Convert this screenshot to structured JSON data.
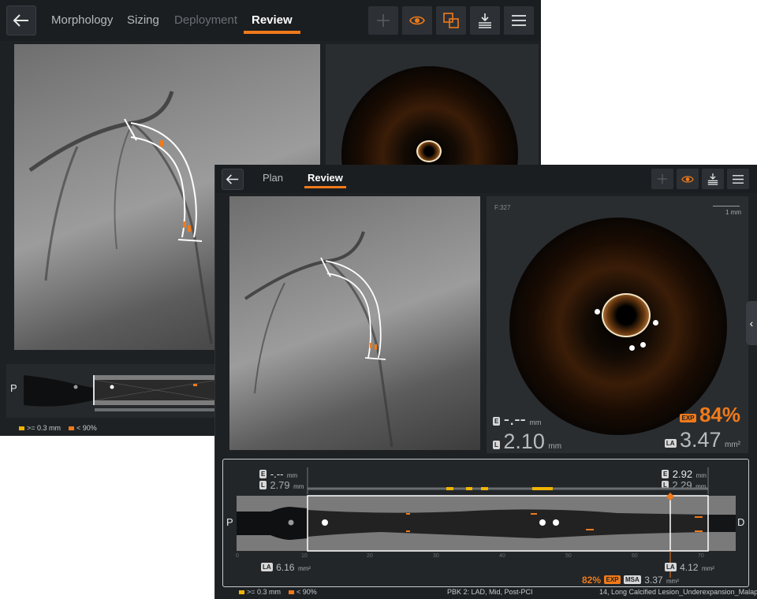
{
  "back_window": {
    "tabs": [
      {
        "label": "Morphology",
        "state": "normal"
      },
      {
        "label": "Sizing",
        "state": "normal"
      },
      {
        "label": "Deployment",
        "state": "disabled"
      },
      {
        "label": "Review",
        "state": "active"
      }
    ],
    "toolbar_icons": [
      "add-icon",
      "eye-icon",
      "overlay-icon",
      "export-icon",
      "menu-icon"
    ],
    "proximal_label": "P",
    "legend": [
      {
        "label": ">= 0.3 mm",
        "color": "#f0b400"
      },
      {
        "label": "< 90%",
        "color": "#f07a1a"
      }
    ]
  },
  "front_window": {
    "tabs": [
      {
        "label": "Plan",
        "state": "normal"
      },
      {
        "label": "Review",
        "state": "active"
      }
    ],
    "toolbar_icons": [
      "add-icon",
      "eye-icon",
      "export-icon",
      "menu-icon"
    ],
    "oct": {
      "frame": "F:327",
      "scale": "1 mm",
      "e_value": "-.--",
      "e_unit": "mm",
      "l_value": "2.10",
      "l_unit": "mm",
      "exp_chip": "EXP",
      "exp_value": "84%",
      "la_chip": "LA",
      "la_value": "3.47",
      "la_unit": "mm²"
    },
    "long_view": {
      "left_e_value": "-.--",
      "left_e_unit": "mm",
      "left_l_value": "2.79",
      "left_l_unit": "mm",
      "right_e_value": "2.92",
      "right_e_unit": "mm",
      "right_l_value": "2.29",
      "right_l_unit": "mm",
      "proximal": "P",
      "distal": "D",
      "axis_ticks": [
        "0",
        "10",
        "20",
        "30",
        "40",
        "50",
        "60",
        "70"
      ],
      "left_la_chip": "LA",
      "left_la_value": "6.16",
      "left_la_unit": "mm²",
      "right_la_chip": "LA",
      "right_la_value": "4.12",
      "right_la_unit": "mm²",
      "exp_pct": "82%",
      "exp_chip": "EXP",
      "msa_chip": "MSA",
      "msa_value": "3.37",
      "msa_unit": "mm²"
    },
    "legend": [
      {
        "label": ">= 0.3 mm",
        "color": "#f0b400"
      },
      {
        "label": "< 90%",
        "color": "#f07a1a"
      }
    ],
    "status": {
      "pbk": "PBK 2:  LAD,  Mid,  Post-PCI",
      "case": "14,  Long Calcified Lesion_Underexpansion_Malap"
    }
  }
}
